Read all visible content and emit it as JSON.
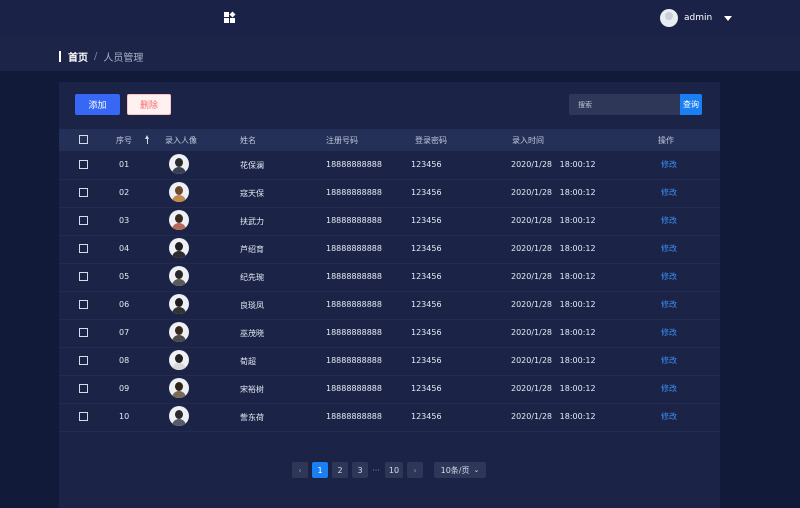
{
  "header": {
    "user_name": "admin",
    "logo_icon": "app-grid-icon",
    "caret_icon": "caret-down-icon"
  },
  "breadcrumb": {
    "home": "首页",
    "separator": "/",
    "current": "人员管理"
  },
  "toolbar": {
    "add_label": "添加",
    "delete_label": "删除",
    "search_placeholder": "搜索",
    "query_label": "查询"
  },
  "table": {
    "headers": {
      "index": "序号",
      "photo": "录入人像",
      "name": "姓名",
      "phone": "注册号码",
      "password": "登录密码",
      "time": "录入时间",
      "action": "操作"
    },
    "rows": [
      {
        "index": "01",
        "name": "花保澜",
        "phone": "18888888888",
        "password": "123456",
        "time": "2020/1/28   18:00:12",
        "action": "修改"
      },
      {
        "index": "02",
        "name": "寇天保",
        "phone": "18888888888",
        "password": "123456",
        "time": "2020/1/28   18:00:12",
        "action": "修改"
      },
      {
        "index": "03",
        "name": "扶武力",
        "phone": "18888888888",
        "password": "123456",
        "time": "2020/1/28   18:00:12",
        "action": "修改"
      },
      {
        "index": "04",
        "name": "芦绍育",
        "phone": "18888888888",
        "password": "123456",
        "time": "2020/1/28   18:00:12",
        "action": "修改"
      },
      {
        "index": "05",
        "name": "纪先琬",
        "phone": "18888888888",
        "password": "123456",
        "time": "2020/1/28   18:00:12",
        "action": "修改"
      },
      {
        "index": "06",
        "name": "良琰凤",
        "phone": "18888888888",
        "password": "123456",
        "time": "2020/1/28   18:00:12",
        "action": "修改"
      },
      {
        "index": "07",
        "name": "巫茂晓",
        "phone": "18888888888",
        "password": "123456",
        "time": "2020/1/28   18:00:12",
        "action": "修改"
      },
      {
        "index": "08",
        "name": "荀超",
        "phone": "18888888888",
        "password": "123456",
        "time": "2020/1/28   18:00:12",
        "action": "修改"
      },
      {
        "index": "09",
        "name": "宋裕树",
        "phone": "18888888888",
        "password": "123456",
        "time": "2020/1/28   18:00:12",
        "action": "修改"
      },
      {
        "index": "10",
        "name": "訾东荷",
        "phone": "18888888888",
        "password": "123456",
        "time": "2020/1/28   18:00:12",
        "action": "修改"
      }
    ]
  },
  "pagination": {
    "prev": "‹",
    "pages": [
      "1",
      "2",
      "3"
    ],
    "ellipsis": "···",
    "last": "10",
    "next": "›",
    "page_size": "10条/页",
    "current_page": "1"
  },
  "colors": {
    "background": "#121a3a",
    "panel": "#1b2447",
    "accent": "#1a7ff2",
    "add_button": "#3767f5",
    "link": "#3d8df5",
    "danger": "#f56c6c"
  }
}
